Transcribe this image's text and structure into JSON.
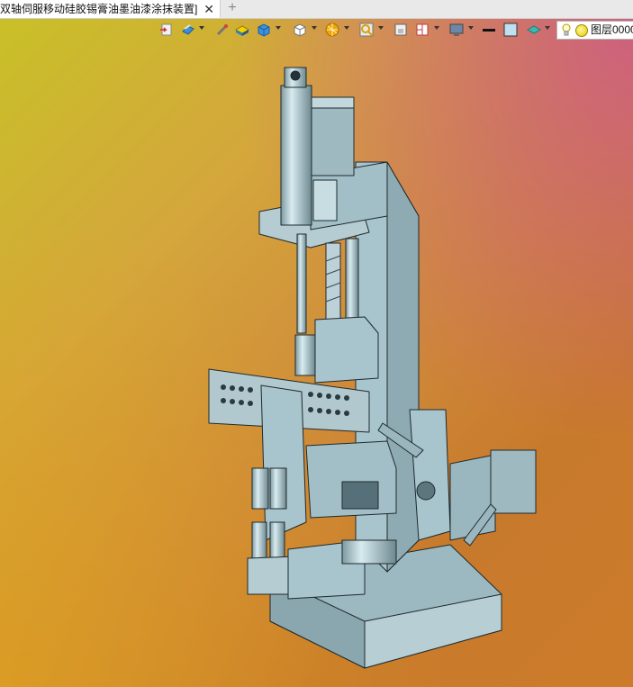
{
  "tab": {
    "title": "双轴伺服移动硅胶锡膏油墨油漆涂抹装置]",
    "close_symbol": "✕",
    "new_tab_symbol": "+"
  },
  "toolbar": {
    "layer_name": "图层0000"
  },
  "viewport": {
    "model_description_icon": "3d-machine-model",
    "model_color": "#a8c4cc"
  }
}
